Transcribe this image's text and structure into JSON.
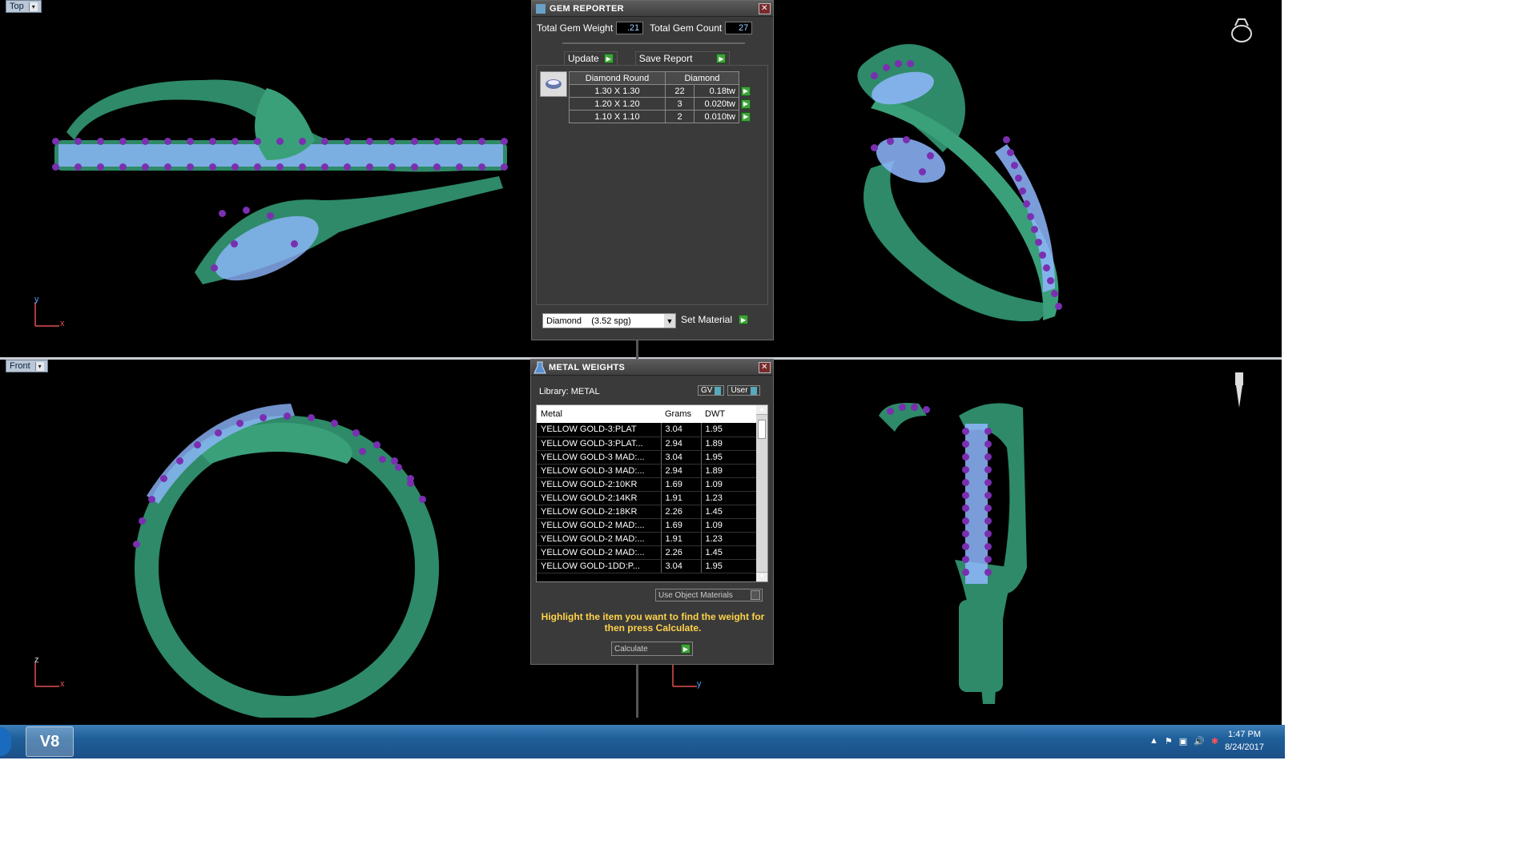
{
  "viewports": {
    "top_label": "Top",
    "front_label": "Front",
    "axes": {
      "tl_v": "y",
      "tl_h": "x",
      "bl_v": "z",
      "bl_h": "x",
      "br_h": "y"
    }
  },
  "gem_reporter": {
    "title": "GEM REPORTER",
    "total_weight_label": "Total Gem Weight",
    "total_weight_value": ".21",
    "total_count_label": "Total Gem Count",
    "total_count_value": "27",
    "update_label": "Update",
    "save_label": "Save Report",
    "table_headers": [
      "Diamond Round",
      "Diamond"
    ],
    "rows": [
      {
        "size": "1.30 X 1.30",
        "count": "22",
        "weight": "0.18tw"
      },
      {
        "size": "1.20 X 1.20",
        "count": "3",
        "weight": "0.020tw"
      },
      {
        "size": "1.10 X 1.10",
        "count": "2",
        "weight": "0.010tw"
      }
    ],
    "material_select": "Diamond    (3.52 spg)",
    "set_material_label": "Set Material"
  },
  "metal_weights": {
    "title": "METAL WEIGHTS",
    "library_label": "Library: METAL",
    "gv_label": "GV",
    "user_label": "User",
    "headers": [
      "Metal",
      "Grams",
      "DWT"
    ],
    "rows": [
      [
        "YELLOW GOLD-3:PLAT",
        "3.04",
        "1.95"
      ],
      [
        "YELLOW GOLD-3:PLAT...",
        "2.94",
        "1.89"
      ],
      [
        "YELLOW GOLD-3 MAD:...",
        "3.04",
        "1.95"
      ],
      [
        "YELLOW GOLD-3 MAD:...",
        "2.94",
        "1.89"
      ],
      [
        "YELLOW GOLD-2:10KR",
        "1.69",
        "1.09"
      ],
      [
        "YELLOW GOLD-2:14KR",
        "1.91",
        "1.23"
      ],
      [
        "YELLOW GOLD-2:18KR",
        "2.26",
        "1.45"
      ],
      [
        "YELLOW GOLD-2 MAD:...",
        "1.69",
        "1.09"
      ],
      [
        "YELLOW GOLD-2 MAD:...",
        "1.91",
        "1.23"
      ],
      [
        "YELLOW GOLD-2 MAD:...",
        "2.26",
        "1.45"
      ],
      [
        "YELLOW GOLD-1DD:P...",
        "3.04",
        "1.95"
      ]
    ],
    "use_object_materials": "Use Object Materials",
    "instruction": "Highlight the item you want to find the weight for then press Calculate.",
    "calculate_label": "Calculate"
  },
  "taskbar": {
    "app_icon": "V8",
    "time": "1:47 PM",
    "date": "8/24/2017"
  },
  "colors": {
    "metal": "#2e8a68",
    "gem_light": "#8fb7ff",
    "gem_prong": "#7a2fb0",
    "instruction": "#ffd24a"
  }
}
